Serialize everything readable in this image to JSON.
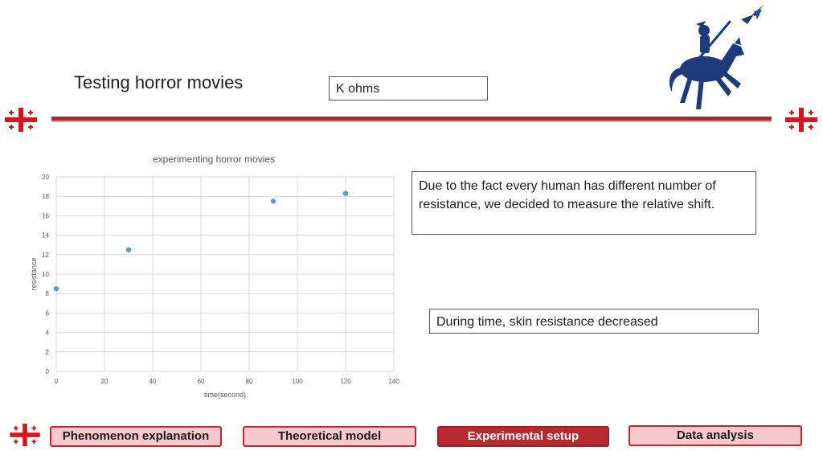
{
  "slide": {
    "title": "Testing horror movies",
    "unit_label": "K ohms"
  },
  "notes": {
    "explanation": "Due to the fact every human has different number of resistance, we decided to measure the relative shift.",
    "conclusion": "During time, skin resistance decreased"
  },
  "nav": {
    "phenomenon": "Phenomenon explanation",
    "theoretical": "Theoretical model",
    "experimental": "Experimental setup",
    "analysis": "Data analysis"
  },
  "icons": {
    "flag": "georgian-flag-icon",
    "logo": "knight-logo-icon"
  },
  "colors": {
    "accent": "#b3242b",
    "nav_active": "#b92a30",
    "nav_inactive": "#f8c9ca",
    "marker": "#5b9bd5"
  },
  "chart_data": {
    "type": "scatter",
    "title": "experimenting horror movies",
    "xlabel": "time(second)",
    "ylabel": "resistance",
    "xlim": [
      0,
      140
    ],
    "ylim": [
      0,
      20
    ],
    "xticks": [
      0,
      20,
      40,
      60,
      80,
      100,
      120,
      140
    ],
    "yticks": [
      0,
      2,
      4,
      6,
      8,
      10,
      12,
      14,
      16,
      18,
      20
    ],
    "grid": true,
    "series": [
      {
        "x": [
          0,
          30,
          90,
          120
        ],
        "y": [
          8.5,
          12.5,
          17.5,
          18.3
        ]
      }
    ]
  }
}
